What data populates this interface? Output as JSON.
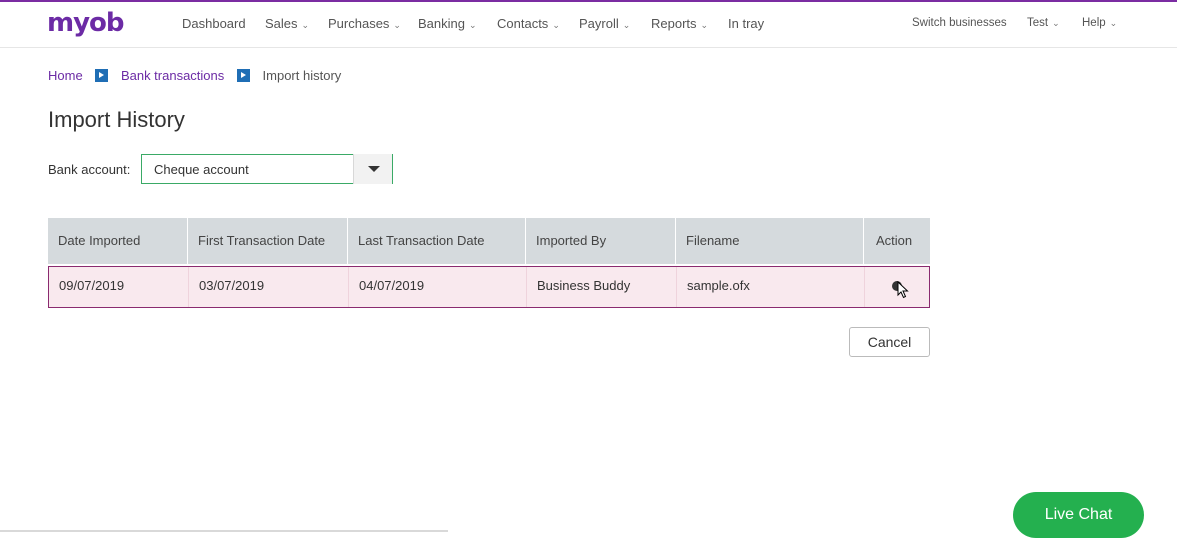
{
  "brand": {
    "logo": "myob",
    "accent": "#6c2ba5"
  },
  "nav": {
    "dashboard": "Dashboard",
    "sales": "Sales",
    "purchases": "Purchases",
    "banking": "Banking",
    "contacts": "Contacts",
    "payroll": "Payroll",
    "reports": "Reports",
    "in_tray": "In tray",
    "switch_businesses": "Switch businesses",
    "test": "Test",
    "help": "Help"
  },
  "breadcrumb": {
    "home": "Home",
    "bank_transactions": "Bank transactions",
    "current": "Import history"
  },
  "page": {
    "title": "Import History"
  },
  "bank_account": {
    "label": "Bank account:",
    "selected": "Cheque account"
  },
  "table": {
    "headers": {
      "date_imported": "Date Imported",
      "first_transaction_date": "First Transaction Date",
      "last_transaction_date": "Last Transaction Date",
      "imported_by": "Imported By",
      "filename": "Filename",
      "action": "Action"
    },
    "rows": [
      {
        "date_imported": "09/07/2019",
        "first_transaction_date": "03/07/2019",
        "last_transaction_date": "04/07/2019",
        "imported_by": "Business Buddy",
        "filename": "sample.ofx",
        "action_icon": "delete-icon"
      }
    ]
  },
  "buttons": {
    "cancel": "Cancel"
  },
  "live_chat": {
    "label": "Live Chat",
    "color": "#24b04f"
  }
}
